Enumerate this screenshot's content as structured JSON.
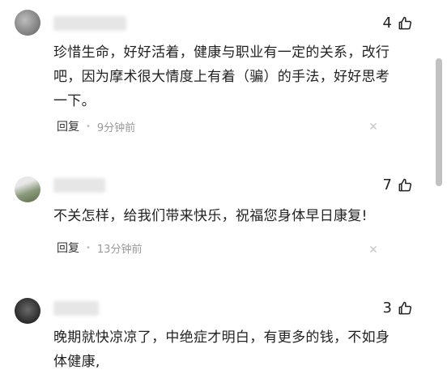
{
  "comments": [
    {
      "likes": "4",
      "content": "珍惜生命，好好活着，健康与职业有一定的关系，改行吧，因为摩术很大情度上有着（骗）的手法，好好思考一下。",
      "reply_label": "回复",
      "time": "9分钟前"
    },
    {
      "likes": "7",
      "content": "不关怎样，给我们带来快乐，祝福您身体早日康复!",
      "reply_label": "回复",
      "time": "13分钟前"
    },
    {
      "likes": "3",
      "content": "晚期就快凉凉了，中绝症才明白，有更多的钱，不如身体健康,"
    }
  ],
  "icons": {
    "like": "thumbs-up-icon",
    "close": "close-icon"
  },
  "colors": {
    "scrollbar": "#c1c1c1",
    "meta_text": "#999999"
  }
}
